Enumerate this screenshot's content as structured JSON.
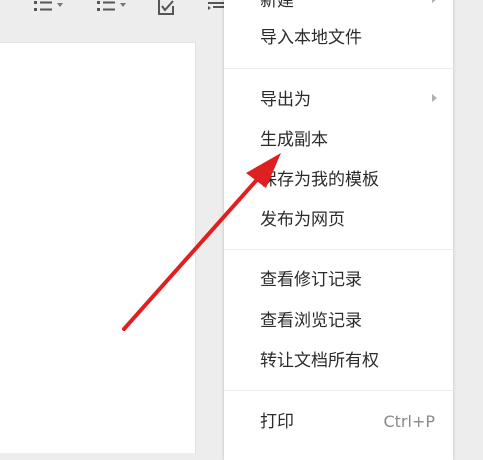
{
  "toolbar": {
    "icons": [
      "bulleted-list-icon",
      "numbered-list-icon",
      "checkbox-icon",
      "indent-icon"
    ]
  },
  "menu": {
    "partial_top_label": "新建",
    "groups": [
      {
        "items": [
          {
            "label": "导入本地文件"
          }
        ]
      },
      {
        "items": [
          {
            "label": "导出为",
            "has_submenu": true
          },
          {
            "label": "生成副本"
          },
          {
            "label": "保存为我的模板"
          },
          {
            "label": "发布为网页"
          }
        ]
      },
      {
        "items": [
          {
            "label": "查看修订记录"
          },
          {
            "label": "查看浏览记录"
          },
          {
            "label": "转让文档所有权"
          }
        ]
      },
      {
        "items": [
          {
            "label": "打印",
            "shortcut": "Ctrl+P"
          }
        ]
      }
    ]
  },
  "colors": {
    "background": "#ededed",
    "menu_background": "#ffffff",
    "menu_text": "#2b2b2b",
    "shortcut_text": "#8a8a8a",
    "annotation_arrow": "#e02020"
  }
}
